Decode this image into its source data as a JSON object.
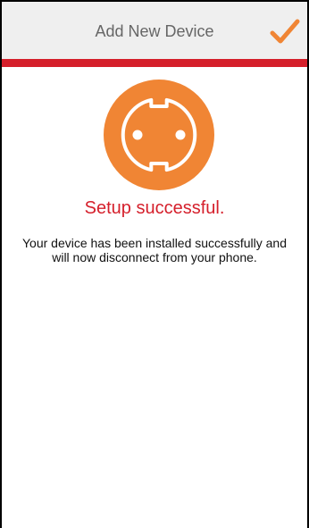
{
  "header": {
    "title": "Add New Device",
    "confirm_icon": "checkmark-icon"
  },
  "device": {
    "icon": "power-socket-icon"
  },
  "status": {
    "title": "Setup successful.",
    "message": "Your device has been installed successfully and will now disconnect from your phone."
  },
  "colors": {
    "header_bg": "#efefef",
    "accent_red": "#d51f2b",
    "icon_orange": "#f08534",
    "frame": "#000000"
  }
}
